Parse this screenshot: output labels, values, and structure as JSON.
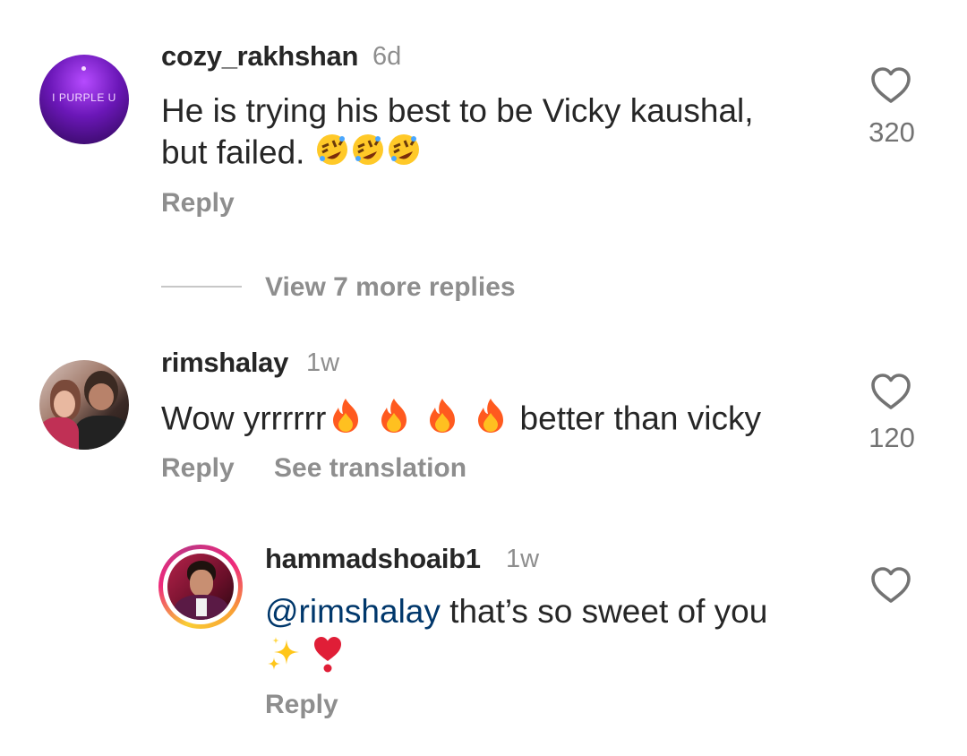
{
  "comments": [
    {
      "username": "cozy_rakhshan",
      "time": "6d",
      "avatar_text": "I PURPLE U",
      "text_line1": "He is trying his best to be Vicky kaushal,",
      "text_line2": "but failed.",
      "emojis": [
        "rolling-laughing-emoji",
        "rolling-laughing-emoji",
        "rolling-laughing-emoji"
      ],
      "reply_label": "Reply",
      "like_count": "320"
    },
    {
      "username": "rimshalay",
      "time": "1w",
      "text_before": "Wow yrrrrrr",
      "text_after": " better than vicky",
      "emojis": [
        "fire-emoji",
        "fire-emoji",
        "fire-emoji",
        "fire-emoji"
      ],
      "reply_label": "Reply",
      "translate_label": "See translation",
      "like_count": "120"
    }
  ],
  "view_more": "View 7 more replies",
  "reply": {
    "username": "hammadshoaib1",
    "time": "1w",
    "mention": "@rimshalay",
    "text": " that’s so sweet of you",
    "emojis": [
      "sparkles-emoji",
      "heart-exclamation-emoji"
    ],
    "reply_label": "Reply"
  },
  "colors": {
    "text": "#262626",
    "secondary": "#8e8e8e",
    "mention": "#00376b",
    "story_ring_start": "#f9ce34",
    "story_ring_mid": "#ee2a7b",
    "story_ring_end": "#6228d7"
  }
}
